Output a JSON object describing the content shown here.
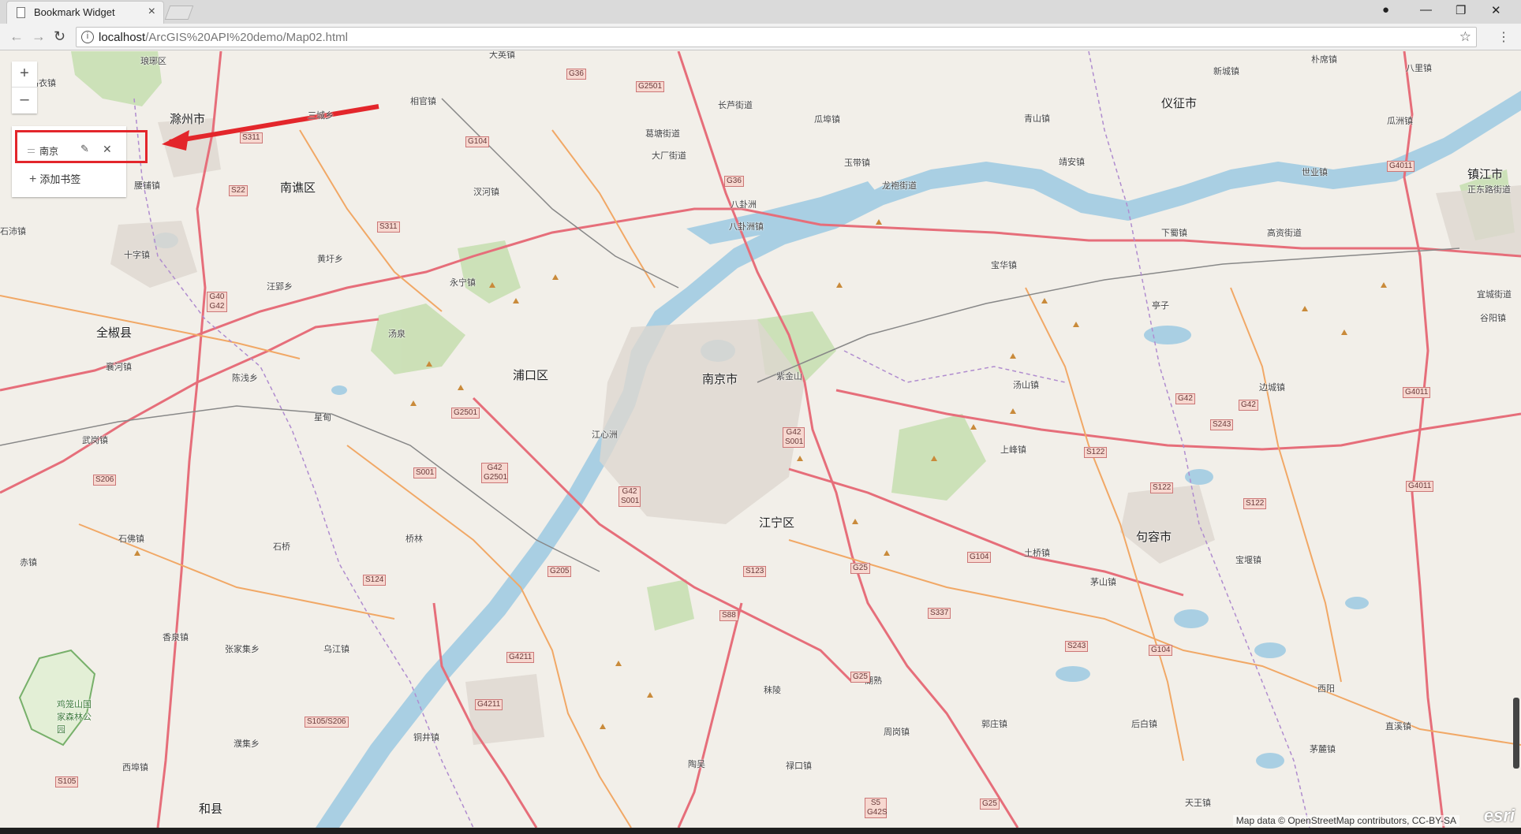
{
  "browser": {
    "tab_title": "Bookmark Widget",
    "tab_close": "×",
    "url_host": "localhost",
    "url_path": "/ArcGIS%20API%20demo/Map02.html",
    "back_icon": "←",
    "forward_icon": "→",
    "reload_icon": "↻",
    "info_icon": "i",
    "star_icon": "☆",
    "menu_icon": "⋮",
    "profile_icon": "●",
    "minimize_icon": "—",
    "restore_icon": "❐",
    "close_icon": "✕"
  },
  "map": {
    "zoom_in": "+",
    "zoom_out": "–",
    "attribution": "Map data © OpenStreetMap contributors, CC-BY-SA",
    "logo": "esri"
  },
  "bookmarks": {
    "items": [
      {
        "label": "南京"
      }
    ],
    "edit_icon": "✎",
    "delete_icon": "✕",
    "add_icon": "+",
    "add_label": "添加书签"
  },
  "labels": {
    "cities": [
      "滁州市",
      "南谯区",
      "全椒县",
      "浦口区",
      "南京市",
      "仪征市",
      "镇江市",
      "江宁区",
      "句容市",
      "和县"
    ],
    "towns": [
      "琅琊区",
      "大英镇",
      "相官镇",
      "三城乡",
      "石沛镇",
      "十字镇",
      "黄圩乡",
      "汪郢乡",
      "汤泉",
      "襄河镇",
      "陈浅乡",
      "星甸",
      "武岗镇",
      "石佛镇",
      "赤镇",
      "香泉镇",
      "张家集乡",
      "乌江镇",
      "鸡笼山国家森林公园",
      "濮集乡",
      "西埠镇",
      "桥林",
      "石桥",
      "铜井镇",
      "陶吴",
      "秣陵",
      "禄口镇",
      "湖熟",
      "周岗镇",
      "郭庄镇",
      "土桥镇",
      "茅山镇",
      "宝堰镇",
      "后白镇",
      "西阳",
      "直溪镇",
      "茅麓镇",
      "天王镇",
      "上峰镇",
      "汤山镇",
      "宝华镇",
      "亭子",
      "边城镇",
      "谷阳镇",
      "宜城街道",
      "高资街道",
      "下蜀镇",
      "世业镇",
      "靖安镇",
      "龙袍街道",
      "玉带镇",
      "青山镇",
      "新城镇",
      "朴席镇",
      "八里镇",
      "瓜洲镇",
      "正东路街道",
      "瓜埠镇",
      "长芦街道",
      "葛塘街道",
      "大厂街道",
      "八卦洲",
      "八卦洲镇",
      "永宁镇",
      "汊河镇",
      "紫金山",
      "江心洲",
      "腰铺镇",
      "乌衣镇"
    ],
    "shields": [
      "G36",
      "G2501",
      "G104",
      "S311",
      "S22",
      "G40 G42",
      "G2501",
      "G42 G2501",
      "S001",
      "G42 S001",
      "G42 S001",
      "G205",
      "S123",
      "S88",
      "G4211",
      "G4211",
      "S105/S206",
      "S337",
      "G25",
      "S243",
      "G104",
      "S243",
      "S122",
      "S122",
      "G4011",
      "G4011",
      "G42",
      "G42",
      "S206",
      "S124",
      "S105",
      "G36",
      "S5 G42S",
      "G25",
      "G25",
      "S122",
      "G104",
      "G4011",
      "S311"
    ]
  }
}
